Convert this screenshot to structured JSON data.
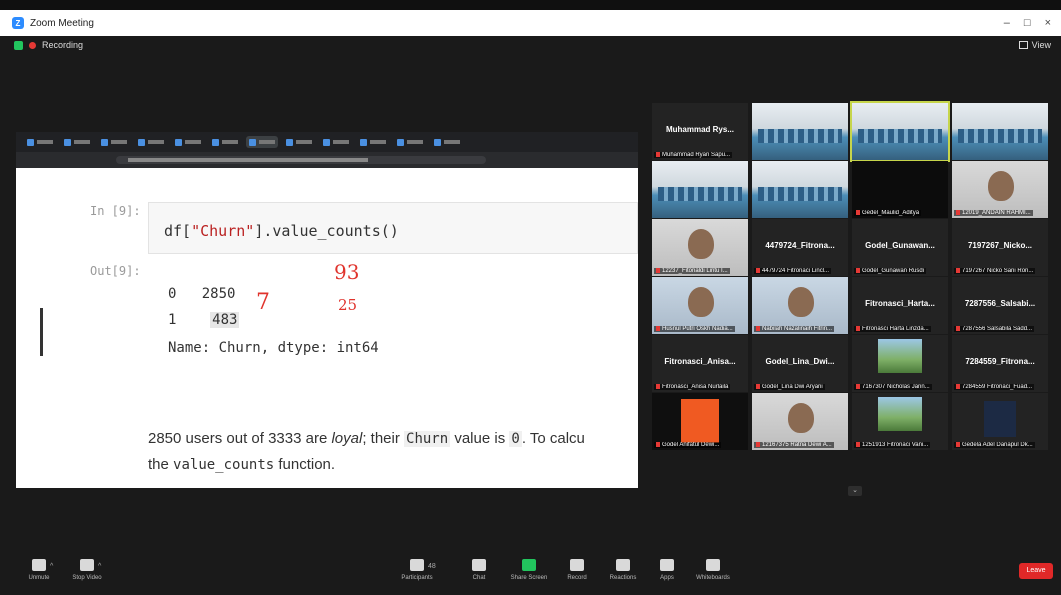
{
  "window": {
    "title": "Zoom Meeting",
    "controls": [
      "–",
      "□",
      "×"
    ]
  },
  "recording": {
    "label": "Recording"
  },
  "view": {
    "label": "View"
  },
  "notebook": {
    "in_prompt": "In [9]:",
    "out_prompt": "Out[9]:",
    "code_fn": "df[",
    "code_str": "\"Churn\"",
    "code_end": "].value_counts()",
    "row0_idx": "0",
    "row0_val": "2850",
    "row1_idx": "1",
    "row1_val": "483",
    "name_line": "Name: Churn, dtype: int64",
    "md1_a": "2850 users out of 3333 are ",
    "md1_italic": "loyal",
    "md1_b": "; their ",
    "md1_code1": "Churn",
    "md1_c": " value is ",
    "md1_code2": "0",
    "md1_d": ". To calcu",
    "md2_a": "the ",
    "md2_code": "value_counts",
    "md2_b": " function."
  },
  "annotations": {
    "a": "93",
    "b": "25",
    "c": "7"
  },
  "participants": [
    {
      "name": "Muhammad Rys...",
      "label": "Muhammad Ryan Sapu..."
    },
    {
      "name": "",
      "label": ""
    },
    {
      "name": "",
      "label": ""
    },
    {
      "name": "",
      "label": ""
    },
    {
      "name": "",
      "label": ""
    },
    {
      "name": "",
      "label": ""
    },
    {
      "name": "",
      "label": "Gedel_Maulid_Aditya"
    },
    {
      "name": "",
      "label": "12019_ANDAIN RAHMI..."
    },
    {
      "name": "",
      "label": "12237_Fitonaldi Lintu I..."
    },
    {
      "name": "4479724_Fitrona...",
      "label": "4479724 Fitronaci Lincl..."
    },
    {
      "name": "Godel_Gunawan...",
      "label": "Godel_Gunawan Rusdi"
    },
    {
      "name": "7197267_Nicko...",
      "label": "7197267 Nicko Sani Ron..."
    },
    {
      "name": "",
      "label": "Husnul Putri Oskh Nadia..."
    },
    {
      "name": "",
      "label": "Nabilah Nazalinaih Fitrin..."
    },
    {
      "name": "Fitronasci_Harta...",
      "label": "Fitronasci Harta Linzda..."
    },
    {
      "name": "7287556_Salsabi...",
      "label": "7287556 Salsabila Sadd..."
    },
    {
      "name": "Fitronasci_Anisa...",
      "label": "Fitronasci_Anisa Nurlaila"
    },
    {
      "name": "Godel_Lina_Dwi...",
      "label": "Godel_Lina Dwi Aryani"
    },
    {
      "name": "",
      "label": "7167307 Nicholas Jann..."
    },
    {
      "name": "7284559_Fitrona...",
      "label": "7284559 Fitronaci_Fuad..."
    },
    {
      "name": "",
      "label": "Godel Anifatul Dewi..."
    },
    {
      "name": "",
      "label": "12167375 Ratna Dewi A..."
    },
    {
      "name": "",
      "label": "1251913 Fitronaci Vani..."
    },
    {
      "name": "",
      "label": "Gedela Adel Danapul Dk..."
    }
  ],
  "toolbar": {
    "mute": "Unmute",
    "video": "Stop Video",
    "participants": "Participants",
    "chat": "Chat",
    "share": "Share Screen",
    "record": "Record",
    "reactions": "Reactions",
    "apps": "Apps",
    "whiteboards": "Whiteboards",
    "participants_count": "48",
    "leave": "Leave"
  },
  "colors": {
    "accent": "#2d8cff",
    "share_green": "#22c55e",
    "leave_red": "#e02828",
    "ink_red": "#e0342d"
  }
}
